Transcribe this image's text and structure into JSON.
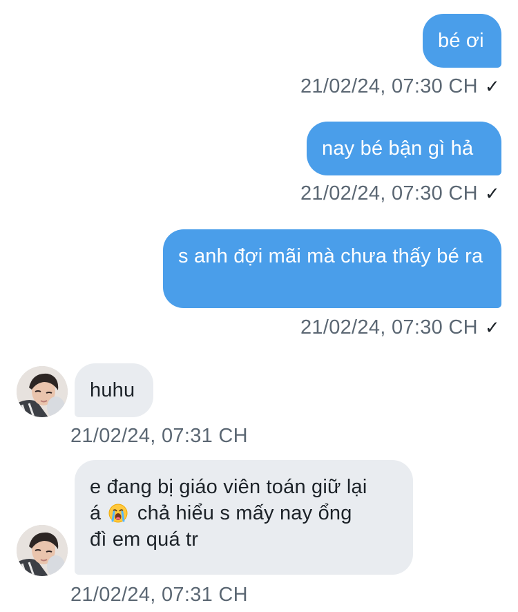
{
  "messages": [
    {
      "side": "out",
      "text": "bé ơi",
      "time": "21/02/24, 07:30 CH",
      "status": "✓"
    },
    {
      "side": "out",
      "text": "nay bé bận gì hả",
      "time": "21/02/24, 07:30 CH",
      "status": "✓"
    },
    {
      "side": "out",
      "text": "s anh đợi mãi mà chưa thấy bé ra",
      "time": "21/02/24, 07:30 CH",
      "status": "✓"
    },
    {
      "side": "in",
      "text": "huhu",
      "time": "21/02/24, 07:31 CH"
    },
    {
      "side": "in",
      "text_line1": "e đang bị giáo viên toán giữ lại",
      "text_line2_before_emoji": "á",
      "emoji": "loudly-crying-face-emoji",
      "text_line2_after_emoji": "chả hiểu s mấy nay ổng",
      "text_line3": "đì em quá tr",
      "time": "21/02/24, 07:31 CH"
    }
  ],
  "colors": {
    "outgoing_bubble": "#4a9eea",
    "incoming_bubble": "#e9ecf0",
    "timestamp_text": "#5b6773"
  }
}
